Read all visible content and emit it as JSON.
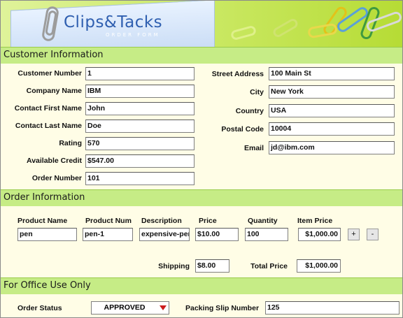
{
  "header": {
    "brand": "Clips&Tacks",
    "subtitle": "ORDER FORM"
  },
  "customer": {
    "section_title": "Customer Information",
    "customer_number": {
      "label": "Customer Number",
      "value": "1"
    },
    "company_name": {
      "label": "Company Name",
      "value": "IBM"
    },
    "contact_first_name": {
      "label": "Contact First Name",
      "value": "John"
    },
    "contact_last_name": {
      "label": "Contact Last Name",
      "value": "Doe"
    },
    "rating": {
      "label": "Rating",
      "value": "570"
    },
    "available_credit": {
      "label": "Available Credit",
      "value": "$547.00"
    },
    "order_number": {
      "label": "Order Number",
      "value": "101"
    },
    "street_address": {
      "label": "Street Address",
      "value": "100 Main St"
    },
    "city": {
      "label": "City",
      "value": "New York"
    },
    "country": {
      "label": "Country",
      "value": "USA"
    },
    "postal_code": {
      "label": "Postal Code",
      "value": "10004"
    },
    "email": {
      "label": "Email",
      "value": "jd@ibm.com"
    }
  },
  "order": {
    "section_title": "Order Information",
    "columns": [
      "Product Name",
      "Product Num",
      "Description",
      "Price",
      "Quantity",
      "Item Price"
    ],
    "line": {
      "product_name": "pen",
      "product_num": "pen-1",
      "description": "expensive-pen",
      "price": "$10.00",
      "quantity": "100",
      "item_price": "$1,000.00"
    },
    "add_label": "+",
    "remove_label": "-",
    "shipping": {
      "label": "Shipping",
      "value": "$8.00"
    },
    "total_price": {
      "label": "Total Price",
      "value": "$1,000.00"
    }
  },
  "office": {
    "section_title": "For Office Use Only",
    "order_status": {
      "label": "Order Status",
      "value": "APPROVED"
    },
    "packing_slip": {
      "label": "Packing Slip Number",
      "value": "125"
    }
  },
  "colors": {
    "section_bar": "#c6ec86",
    "panel": "#fffde6",
    "banner_green": "#b6dc35",
    "brand_blue": "#2f5fb0",
    "status_arrow": "#cc1b1b"
  },
  "icons": [
    "paperclip-icon",
    "dropdown-arrow-icon"
  ]
}
